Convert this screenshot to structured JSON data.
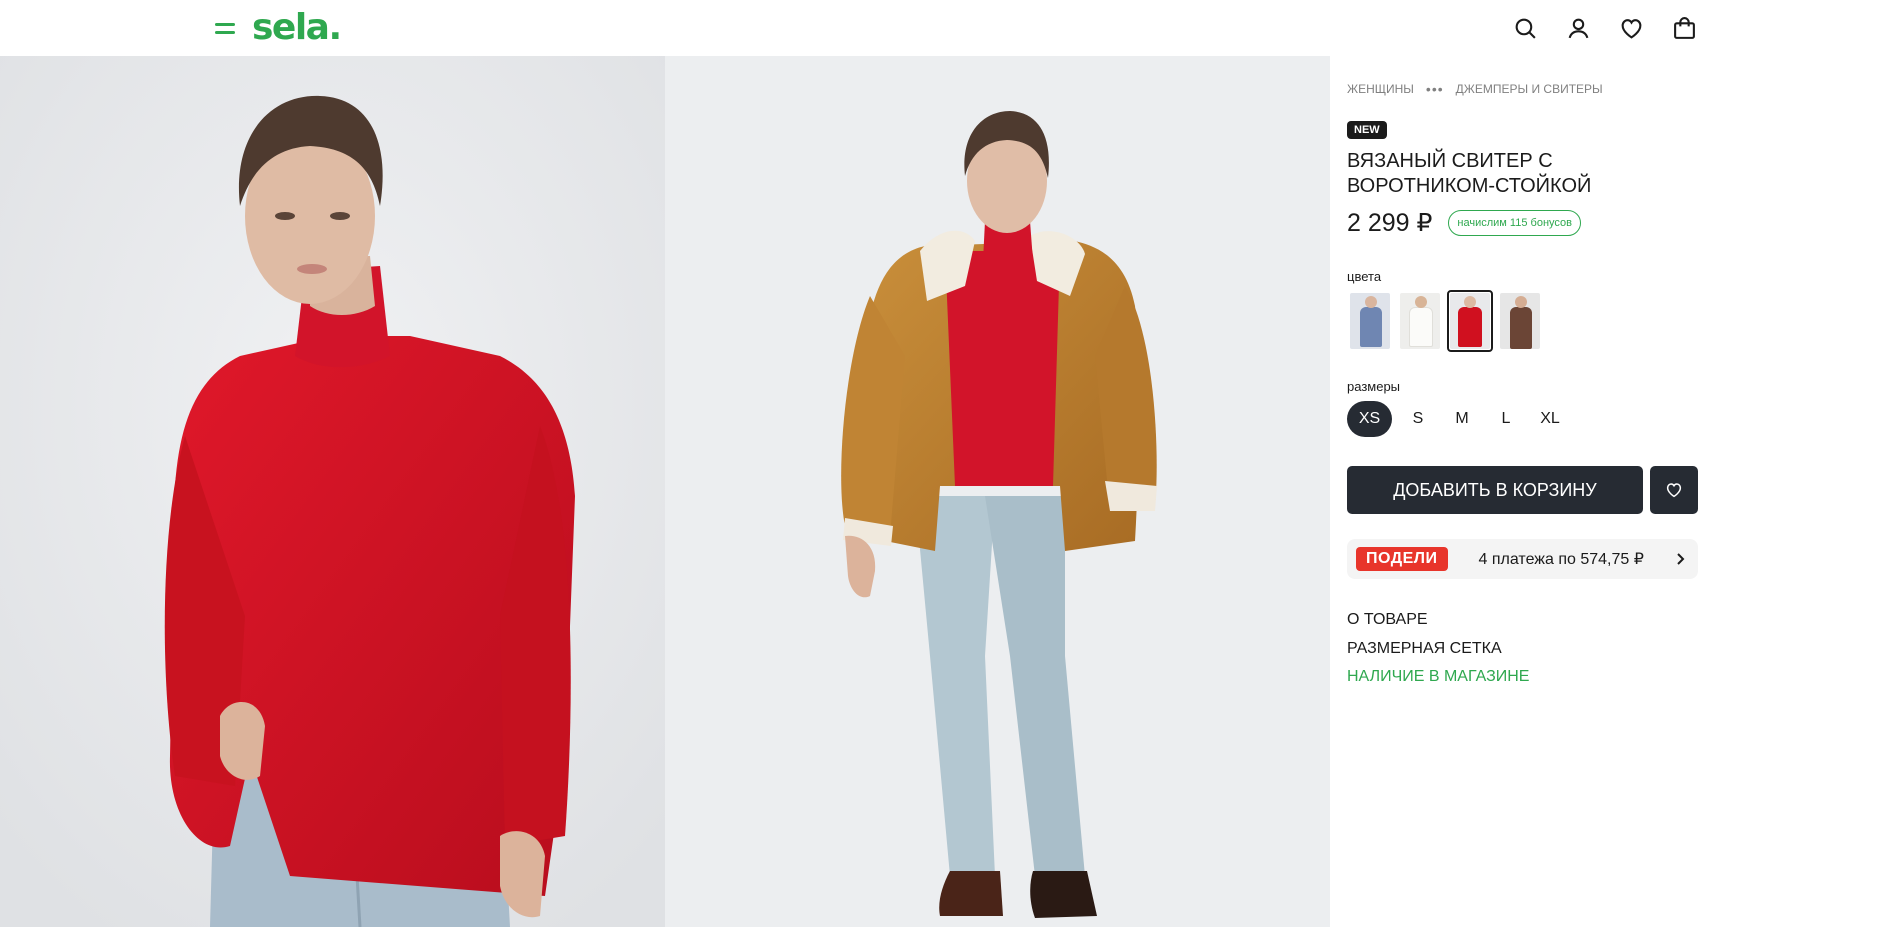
{
  "brand": {
    "logo_text": "sela.",
    "accent_color": "#2fa84f"
  },
  "header": {
    "icons": [
      "menu-icon",
      "search-icon",
      "account-icon",
      "heart-icon",
      "bag-icon"
    ]
  },
  "breadcrumb": {
    "items": [
      "ЖЕНЩИНЫ",
      "ДЖЕМПЕРЫ И СВИТЕРЫ"
    ],
    "ellipsis": "•••"
  },
  "product": {
    "badge": "NEW",
    "title": "ВЯЗАНЫЙ СВИТЕР С ВОРОТНИКОМ-СТОЙКОЙ",
    "price": "2 299 ₽",
    "bonus": "начислим 115 бонусов",
    "colors_label": "цвета",
    "colors": [
      {
        "name": "blue",
        "hex": "#6f86b2",
        "active": false
      },
      {
        "name": "white",
        "hex": "#ecebe6",
        "active": false
      },
      {
        "name": "red",
        "hex": "#d0101f",
        "active": true
      },
      {
        "name": "brown",
        "hex": "#6b4536",
        "active": false
      }
    ],
    "sizes_label": "размеры",
    "sizes": [
      "XS",
      "S",
      "M",
      "L",
      "XL"
    ],
    "selected_size": "XS",
    "add_to_cart": "ДОБАВИТЬ В КОРЗИНУ"
  },
  "podeli": {
    "logo": "ПОДЕЛИ",
    "text": "4 платежа по 574,75 ₽"
  },
  "info_links": {
    "about": "О ТОВАРЕ",
    "size_chart": "РАЗМЕРНАЯ СЕТКА",
    "in_store": "НАЛИЧИЕ В МАГАЗИНЕ"
  }
}
